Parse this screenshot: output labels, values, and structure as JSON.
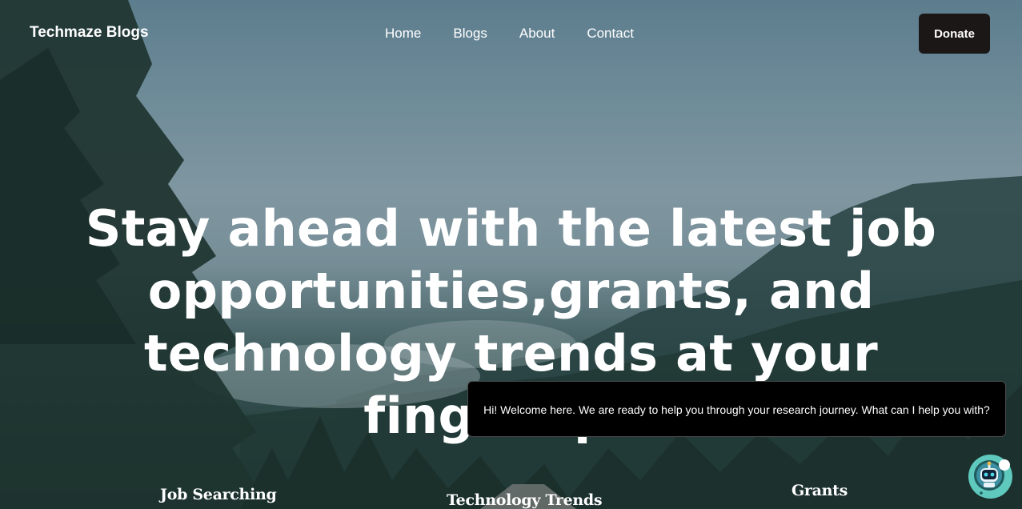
{
  "nav": {
    "brand": "Techmaze Blogs",
    "links": [
      "Home",
      "Blogs",
      "About",
      "Contact"
    ],
    "donate_label": "Donate"
  },
  "hero": {
    "headline": "Stay ahead with the latest job opportunities,grants, and technology trends at your fingertips."
  },
  "chat": {
    "welcome_message": "Hi! Welcome here. We are ready to help you through your research journey. What can I help you with?",
    "launcher_icon": "robot-icon"
  },
  "categories": [
    "Job Searching",
    "Technology Trends",
    "Grants"
  ],
  "colors": {
    "donate_bg": "#1a1716",
    "chat_bg": "#000000",
    "launcher_bg": "#5fc9bd"
  }
}
